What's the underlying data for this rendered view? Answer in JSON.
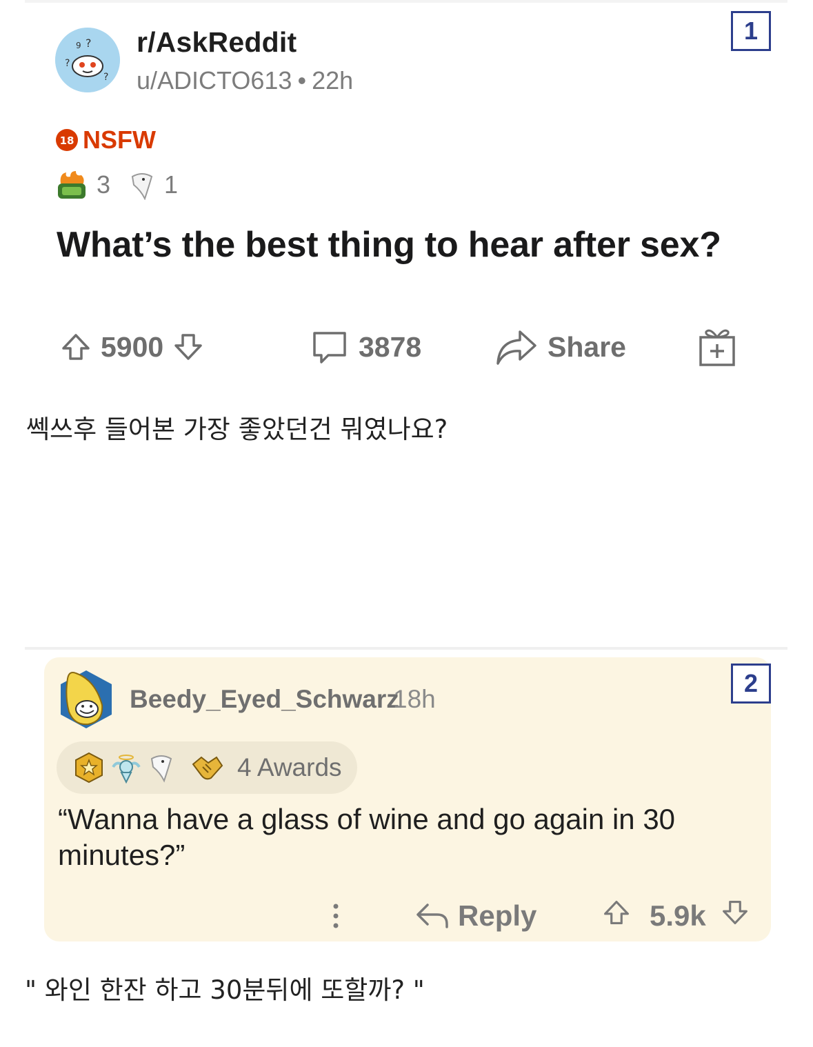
{
  "post": {
    "subreddit": "r/AskReddit",
    "author": "u/ADICTO613",
    "separator": "•",
    "age": "22h",
    "nsfw_label": "NSFW",
    "nsfw_badge_text": "18",
    "awards": [
      {
        "icon": "burning-cash-icon",
        "count": "3"
      },
      {
        "icon": "wholesome-seal-icon",
        "count": "1"
      }
    ],
    "title": "What’s the best thing to hear after sex?",
    "upvotes": "5900",
    "comments": "3878",
    "share_label": "Share"
  },
  "markers": {
    "first": "1",
    "second": "2"
  },
  "translation_1": "쎅쓰후 들어본 가장 좋았던건 뭐였나요?",
  "comment": {
    "author": "Beedy_Eyed_Schwarz",
    "age": "18h",
    "awards_label": "4 Awards",
    "award_icons": [
      "gold-medal-icon",
      "angel-icon",
      "wholesome-seal-icon",
      "handshake-icon"
    ],
    "text": "“Wanna have a glass of wine and go again in 30 minutes?”",
    "reply_label": "Reply",
    "score": "5.9k"
  },
  "translation_2": "\"  와인 한잔 하고 30분뒤에 또할까? \"",
  "colors": {
    "nsfw": "#d93a00",
    "marker": "#2c3e8c",
    "comment_bg": "#fcf5e2",
    "muted": "#7c7c7c"
  }
}
